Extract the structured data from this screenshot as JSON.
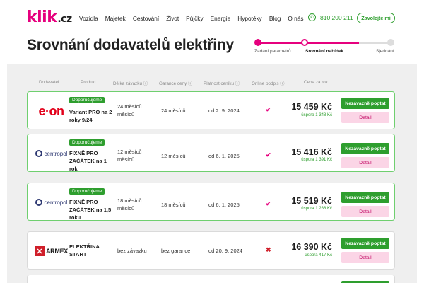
{
  "header": {
    "logo_main": "klik",
    "logo_tld": ".cz",
    "nav": [
      "Vozidla",
      "Majetek",
      "Cestování",
      "Život",
      "Půjčky",
      "Energie",
      "Hypotéky",
      "Blog",
      "O nás"
    ],
    "phone": "810 200 211",
    "call_label": "Zavolejte mi"
  },
  "page_title": "Srovnání dodavatelů elektřiny",
  "stepper": {
    "steps": [
      "Zadání parametrů",
      "Srovnání nabídek",
      "Sjednání"
    ],
    "active_index": 1
  },
  "columns": [
    "Dodavatel",
    "Produkt",
    "Délka závazku ⓘ",
    "Garance ceny ⓘ",
    "Platnost ceníku ⓘ",
    "Online podpis ⓘ",
    "Cena za rok"
  ],
  "offers": [
    {
      "supplier": "e·on",
      "recommended": true,
      "badge": "Doporučujeme",
      "product": "Variant PRO na 2 roky 9/24",
      "commitment": "24 měsíců měsíců",
      "price_guarantee": "24 měsíců",
      "validity": "od 2. 9. 2024",
      "online_sign": true,
      "price": "15 459 Kč",
      "saving": "úspora 1 348 Kč",
      "ask_label": "Nezávazně poptat",
      "detail_label": "Detail"
    },
    {
      "supplier": "centropol",
      "recommended": true,
      "badge": "Doporučujeme",
      "product": "FIXNĚ PRO ZAČÁTEK na 1 rok",
      "commitment": "12 měsíců měsíců",
      "price_guarantee": "12 měsíců",
      "validity": "od 6. 1. 2025",
      "online_sign": true,
      "price": "15 416 Kč",
      "saving": "úspora 1 391 Kč",
      "ask_label": "Nezávazně poptat",
      "detail_label": "Detail"
    },
    {
      "supplier": "centropol",
      "recommended": true,
      "badge": "Doporučujeme",
      "product": "FIXNĚ PRO ZAČÁTEK na 1,5 roku",
      "commitment": "18 měsíců měsíců",
      "price_guarantee": "18 měsíců",
      "validity": "od 6. 1. 2025",
      "online_sign": true,
      "price": "15 519 Kč",
      "saving": "úspora 1 288 Kč",
      "ask_label": "Nezávazně poptat",
      "detail_label": "Detail"
    },
    {
      "supplier": "ARMEX",
      "recommended": false,
      "product": "ELEKTŘINA START",
      "commitment": "bez závazku",
      "price_guarantee": "bez garance",
      "validity": "od 20. 9. 2024",
      "online_sign": false,
      "price": "16 390 Kč",
      "saving": "úspora 417 Kč",
      "ask_label": "Nezávazně poptat",
      "detail_label": "Detail"
    }
  ],
  "colors": {
    "brand": "#e6007e",
    "accent_green": "#2e9e2e",
    "detail_bg": "#fbd5e6"
  }
}
